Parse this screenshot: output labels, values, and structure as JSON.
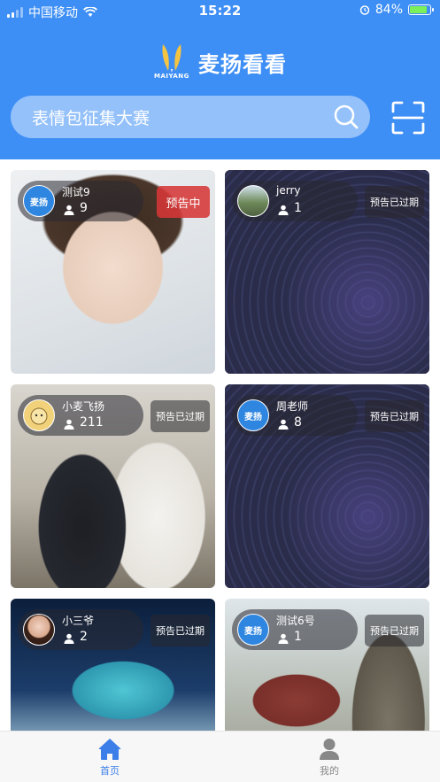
{
  "status_bar": {
    "carrier": "中国移动",
    "time": "15:22",
    "battery": "84%"
  },
  "header": {
    "logo_sub": "MAIYANG",
    "app_title": "麦扬看看",
    "search_placeholder": "表情包征集大赛"
  },
  "cards": [
    {
      "owner_name": "测试9",
      "count": "9",
      "badge": "预告中",
      "avatar_text": "麦扬"
    },
    {
      "owner_name": "jerry",
      "count": "1",
      "badge": "预告已过期",
      "avatar_text": ""
    },
    {
      "owner_name": "小麦飞扬",
      "count": "211",
      "badge": "预告已过期",
      "avatar_text": ""
    },
    {
      "owner_name": "周老师",
      "count": "8",
      "badge": "预告已过期",
      "avatar_text": "麦扬"
    },
    {
      "owner_name": "小三爷",
      "count": "2",
      "badge": "预告已过期",
      "avatar_text": ""
    },
    {
      "owner_name": "测试6号",
      "count": "1",
      "badge": "预告已过期",
      "avatar_text": "麦扬"
    }
  ],
  "tabbar": {
    "home": "首页",
    "mine": "我的"
  },
  "colors": {
    "brand_blue": "#3d8ef5",
    "badge_active": "#d63737",
    "tab_active": "#3d7fe8",
    "tab_inactive": "#888888"
  },
  "icons": {
    "search": "search-icon",
    "scan": "scan-icon",
    "home": "home-icon",
    "mine": "user-icon",
    "person": "person-icon"
  }
}
